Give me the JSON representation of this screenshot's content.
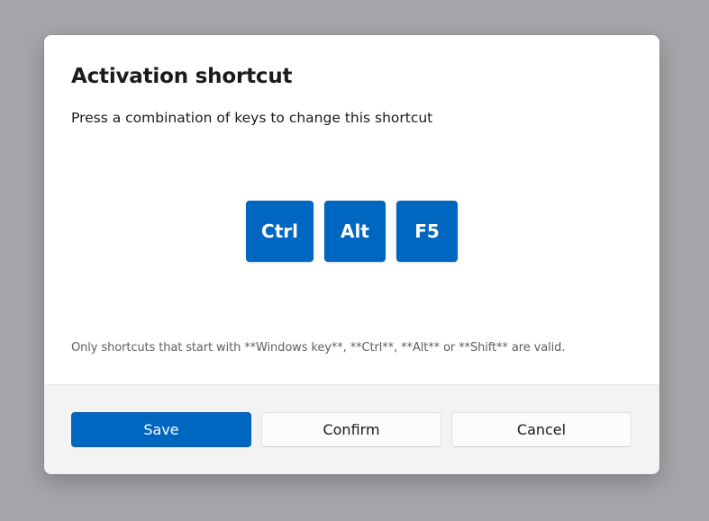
{
  "dialog": {
    "title": "Activation shortcut",
    "subtitle": "Press a combination of keys to change this shortcut",
    "keys": [
      "Ctrl",
      "Alt",
      "F5"
    ],
    "note": "Only shortcuts that start with **Windows key**, **Ctrl**, **Alt** or **Shift** are valid.",
    "buttons": {
      "save": "Save",
      "confirm": "Confirm",
      "cancel": "Cancel"
    }
  },
  "colors": {
    "accent": "#0067c0",
    "backdrop": "#a3a5a8",
    "footer": "#f3f3f3"
  }
}
